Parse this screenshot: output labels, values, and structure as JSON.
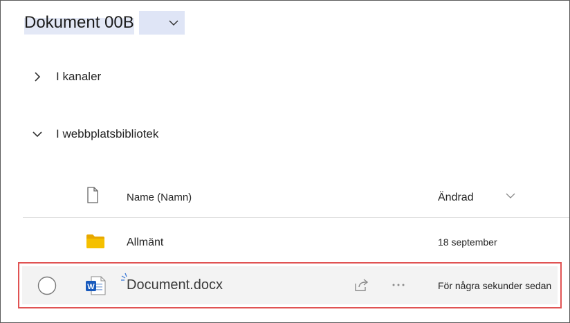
{
  "header": {
    "title": "Dokument 00B"
  },
  "sections": [
    {
      "label": "I kanaler",
      "expanded": false
    },
    {
      "label": "I webbplatsbibliotek",
      "expanded": true
    }
  ],
  "columns": {
    "name": "Name (Namn)",
    "modified": "Ändrad"
  },
  "rows": [
    {
      "type": "folder",
      "name": "Allmänt",
      "modified": "18 september"
    },
    {
      "type": "word",
      "name": "Document.docx",
      "modified": "För några sekunder sedan"
    }
  ],
  "colors": {
    "highlight": "#dfe5f6",
    "folder": "#f5b800",
    "word": "#185abd",
    "selection_border": "#e05353"
  }
}
